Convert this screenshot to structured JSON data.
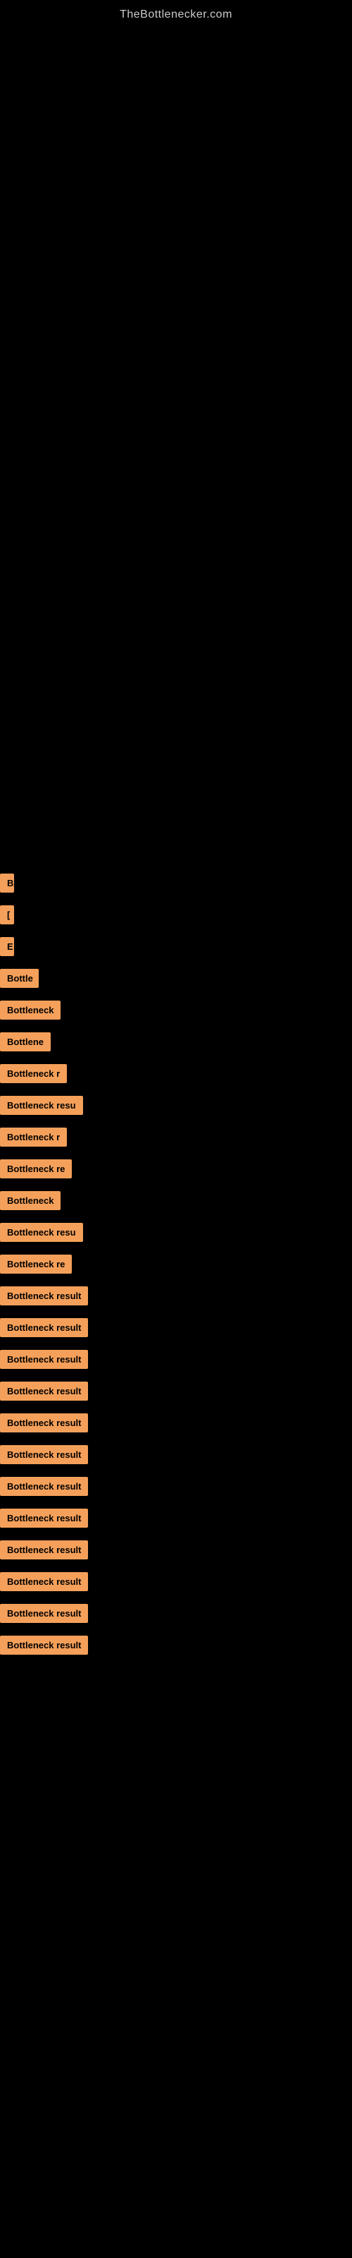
{
  "header": {
    "site_title": "TheBottlenecker.com"
  },
  "items": [
    {
      "id": 1,
      "label": "B",
      "width": 20
    },
    {
      "id": 2,
      "label": "[",
      "width": 20
    },
    {
      "id": 3,
      "label": "E",
      "width": 20
    },
    {
      "id": 4,
      "label": "Bottle",
      "width": 55
    },
    {
      "id": 5,
      "label": "Bottleneck",
      "width": 90
    },
    {
      "id": 6,
      "label": "Bottlene",
      "width": 80
    },
    {
      "id": 7,
      "label": "Bottleneck r",
      "width": 110
    },
    {
      "id": 8,
      "label": "Bottleneck resu",
      "width": 130
    },
    {
      "id": 9,
      "label": "Bottleneck r",
      "width": 110
    },
    {
      "id": 10,
      "label": "Bottleneck re",
      "width": 120
    },
    {
      "id": 11,
      "label": "Bottleneck",
      "width": 90
    },
    {
      "id": 12,
      "label": "Bottleneck resu",
      "width": 130
    },
    {
      "id": 13,
      "label": "Bottleneck re",
      "width": 120
    },
    {
      "id": 14,
      "label": "Bottleneck result",
      "width": 145
    },
    {
      "id": 15,
      "label": "Bottleneck result",
      "width": 145
    },
    {
      "id": 16,
      "label": "Bottleneck result",
      "width": 145
    },
    {
      "id": 17,
      "label": "Bottleneck result",
      "width": 145
    },
    {
      "id": 18,
      "label": "Bottleneck result",
      "width": 145
    },
    {
      "id": 19,
      "label": "Bottleneck result",
      "width": 145
    },
    {
      "id": 20,
      "label": "Bottleneck result",
      "width": 145
    },
    {
      "id": 21,
      "label": "Bottleneck result",
      "width": 145
    },
    {
      "id": 22,
      "label": "Bottleneck result",
      "width": 145
    },
    {
      "id": 23,
      "label": "Bottleneck result",
      "width": 145
    },
    {
      "id": 24,
      "label": "Bottleneck result",
      "width": 145
    },
    {
      "id": 25,
      "label": "Bottleneck result",
      "width": 145
    }
  ]
}
